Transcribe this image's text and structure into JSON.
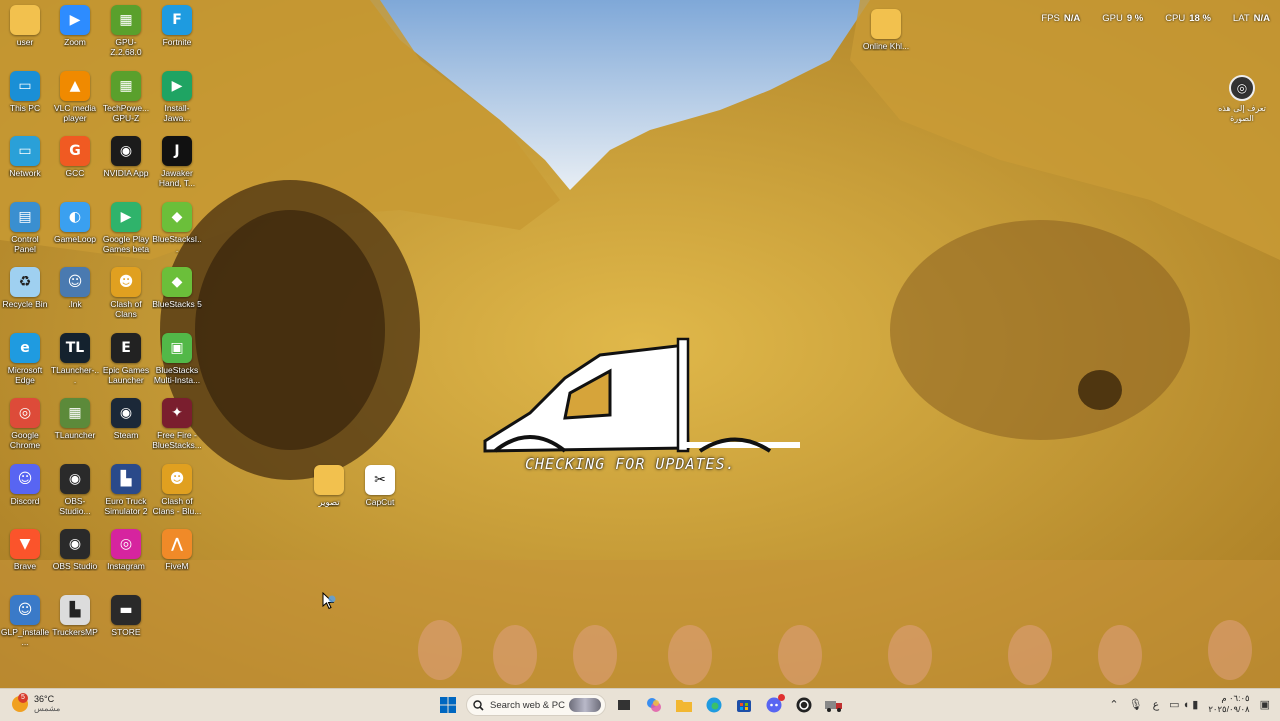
{
  "desktop": {
    "icons": [
      {
        "label": "user",
        "glyph": "",
        "color": "#f2c14e",
        "col": 0,
        "row": 0,
        "icon": "folder-icon"
      },
      {
        "label": "Zoom",
        "glyph": "▶",
        "color": "#2d8cff",
        "col": 1,
        "row": 0,
        "icon": "zoom-icon"
      },
      {
        "label": "GPU-Z.2.68.0",
        "glyph": "▦",
        "color": "#5aa02c",
        "col": 2,
        "row": 0,
        "icon": "gpu-z-icon"
      },
      {
        "label": "Fortnite",
        "glyph": "F",
        "color": "#1e9be0",
        "col": 3,
        "row": 0,
        "icon": "fortnite-icon"
      },
      {
        "label": "This PC",
        "glyph": "▭",
        "color": "#1a8fd6",
        "col": 0,
        "row": 1,
        "icon": "computer-icon"
      },
      {
        "label": "VLC media player",
        "glyph": "▲",
        "color": "#f08a00",
        "col": 1,
        "row": 1,
        "icon": "vlc-icon"
      },
      {
        "label": "TechPowe... GPU-Z",
        "glyph": "▦",
        "color": "#5aa02c",
        "col": 2,
        "row": 1,
        "icon": "gpu-z-icon"
      },
      {
        "label": "Install-Jawa... Hand, Tarn...",
        "glyph": "▶",
        "color": "#1fa463",
        "col": 3,
        "row": 1,
        "icon": "google-play-icon"
      },
      {
        "label": "Network",
        "glyph": "▭",
        "color": "#2aa0d8",
        "col": 0,
        "row": 2,
        "icon": "network-icon"
      },
      {
        "label": "GCC",
        "glyph": "G",
        "color": "#f05a22",
        "col": 1,
        "row": 2,
        "icon": "gcc-icon"
      },
      {
        "label": "NVIDIA App",
        "glyph": "◉",
        "color": "#1b1b1b",
        "col": 2,
        "row": 2,
        "icon": "nvidia-icon"
      },
      {
        "label": "Jawaker Hand, T...",
        "glyph": "J",
        "color": "#111111",
        "col": 3,
        "row": 2,
        "icon": "jawaker-icon"
      },
      {
        "label": "Control Panel",
        "glyph": "▤",
        "color": "#3a8fd0",
        "col": 0,
        "row": 3,
        "icon": "control-panel-icon"
      },
      {
        "label": "GameLoop",
        "glyph": "◐",
        "color": "#3aa0f0",
        "col": 1,
        "row": 3,
        "icon": "gameloop-icon"
      },
      {
        "label": "Google Play Games beta",
        "glyph": "▶",
        "color": "#2fb36b",
        "col": 2,
        "row": 3,
        "icon": "google-play-games-icon"
      },
      {
        "label": "BlueStacksI...",
        "glyph": "◆",
        "color": "#6bbf3a",
        "col": 3,
        "row": 3,
        "icon": "bluestacks-icon"
      },
      {
        "label": "Recycle Bin",
        "glyph": "♻",
        "color": "#9fd0f0",
        "col": 0,
        "row": 4,
        "icon": "recycle-bin-icon"
      },
      {
        "label": ".lnk",
        "glyph": "☺",
        "color": "#4a7ab0",
        "col": 1,
        "row": 4,
        "icon": "shortcut-icon"
      },
      {
        "label": "Clash of Clans",
        "glyph": "☻",
        "color": "#e0a020",
        "col": 2,
        "row": 4,
        "icon": "clash-of-clans-icon"
      },
      {
        "label": "BlueStacks 5",
        "glyph": "◆",
        "color": "#6bbf3a",
        "col": 3,
        "row": 4,
        "icon": "bluestacks-icon"
      },
      {
        "label": "Microsoft Edge",
        "glyph": "e",
        "color": "#1f9be0",
        "col": 0,
        "row": 5,
        "icon": "edge-icon"
      },
      {
        "label": "TLauncher-...",
        "glyph": "TL",
        "color": "#14222e",
        "col": 1,
        "row": 5,
        "icon": "tlauncher-icon"
      },
      {
        "label": "Epic Games Launcher",
        "glyph": "E",
        "color": "#222222",
        "col": 2,
        "row": 5,
        "icon": "epic-games-icon"
      },
      {
        "label": "BlueStacks Multi-Insta...",
        "glyph": "▣",
        "color": "#52b848",
        "col": 3,
        "row": 5,
        "icon": "bluestacks-multi-icon"
      },
      {
        "label": "Google Chrome",
        "glyph": "◎",
        "color": "#dd4b39",
        "col": 0,
        "row": 6,
        "icon": "chrome-icon"
      },
      {
        "label": "TLauncher",
        "glyph": "▦",
        "color": "#5c8a3a",
        "col": 1,
        "row": 6,
        "icon": "tlauncher-block-icon"
      },
      {
        "label": "Steam",
        "glyph": "◉",
        "color": "#1b2838",
        "col": 2,
        "row": 6,
        "icon": "steam-icon"
      },
      {
        "label": "Free Fire - BlueStacks...",
        "glyph": "✦",
        "color": "#7a1e2e",
        "col": 3,
        "row": 6,
        "icon": "free-fire-icon"
      },
      {
        "label": "Discord",
        "glyph": "☺",
        "color": "#5865f2",
        "col": 0,
        "row": 7,
        "icon": "discord-icon"
      },
      {
        "label": "OBS-Studio...",
        "glyph": "◉",
        "color": "#2a2a2a",
        "col": 1,
        "row": 7,
        "icon": "obs-icon"
      },
      {
        "label": "Euro Truck Simulator 2",
        "glyph": "▙",
        "color": "#2a4a8a",
        "col": 2,
        "row": 7,
        "icon": "euro-truck-icon"
      },
      {
        "label": "Clash of Clans - Blu...",
        "glyph": "☻",
        "color": "#e0a020",
        "col": 3,
        "row": 7,
        "icon": "clash-of-clans-icon"
      },
      {
        "label": "Brave",
        "glyph": "▼",
        "color": "#fb542b",
        "col": 0,
        "row": 8,
        "icon": "brave-icon"
      },
      {
        "label": "OBS Studio",
        "glyph": "◉",
        "color": "#2a2a2a",
        "col": 1,
        "row": 8,
        "icon": "obs-icon"
      },
      {
        "label": "Instagram",
        "glyph": "◎",
        "color": "#d6249f",
        "col": 2,
        "row": 8,
        "icon": "instagram-icon"
      },
      {
        "label": "FiveM",
        "glyph": "⋀",
        "color": "#f08a28",
        "col": 3,
        "row": 8,
        "icon": "fivem-icon"
      },
      {
        "label": "GLP_installe...",
        "glyph": "☺",
        "color": "#3a7ac8",
        "col": 0,
        "row": 9,
        "icon": "glp-installer-icon"
      },
      {
        "label": "TruckersMP",
        "glyph": "▙",
        "color": "#dcdcdc",
        "col": 1,
        "row": 9,
        "icon": "truckersmp-icon"
      },
      {
        "label": "STORE",
        "glyph": "▬",
        "color": "#2a2a2a",
        "col": 2,
        "row": 9,
        "icon": "store-icon"
      }
    ],
    "extra_icons": [
      {
        "label": "تصوير",
        "glyph": "",
        "color": "#f2c14e",
        "icon": "folder-icon"
      },
      {
        "label": "CapCut",
        "glyph": "✂",
        "color": "#ffffff",
        "icon": "capcut-icon"
      },
      {
        "label": "Online Khl...",
        "glyph": "",
        "color": "#f2c14e",
        "icon": "folder-icon"
      }
    ]
  },
  "perf": {
    "fps_label": "FPS",
    "fps_value": "N/A",
    "gpu_label": "GPU",
    "gpu_value": "9 %",
    "cpu_label": "CPU",
    "cpu_value": "18 %",
    "lat_label": "LAT",
    "lat_value": "N/A"
  },
  "lens": {
    "label": "تعرف إلى هذه الصورة"
  },
  "splash": {
    "text": "CHECKING FOR UPDATES."
  },
  "taskbar": {
    "weather_temp": "36°C",
    "weather_desc": "مشمس",
    "weather_badge": "5",
    "search_placeholder": "Search web & PC",
    "lang": "ع",
    "time": "٠٦:٠٥ م",
    "date": "٢٠٢٥/٠٩/٠٨",
    "accent": "#0067c0"
  }
}
